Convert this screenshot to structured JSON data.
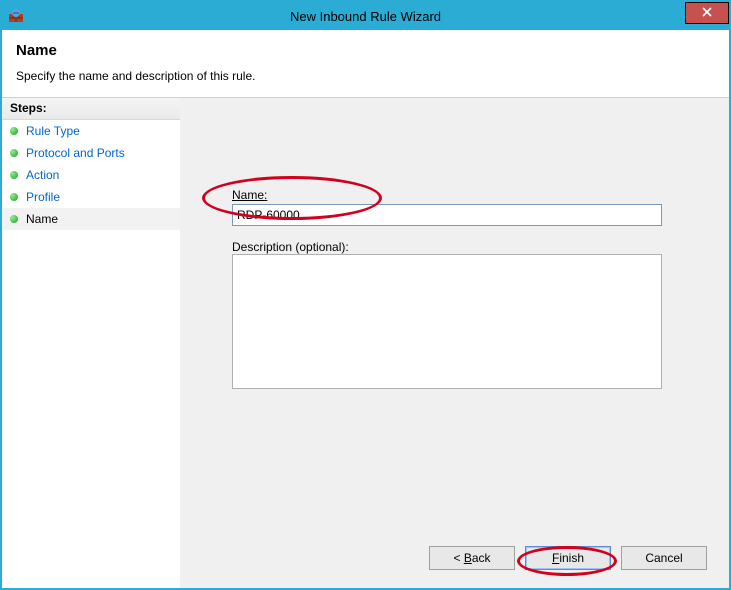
{
  "window": {
    "title": "New Inbound Rule Wizard"
  },
  "header": {
    "title": "Name",
    "subtitle": "Specify the name and description of this rule."
  },
  "sidebar": {
    "steps_label": "Steps:",
    "items": [
      {
        "label": "Rule Type"
      },
      {
        "label": "Protocol and Ports"
      },
      {
        "label": "Action"
      },
      {
        "label": "Profile"
      },
      {
        "label": "Name"
      }
    ]
  },
  "form": {
    "name_label": "Name:",
    "name_value": "RDP-60000",
    "description_label": "Description (optional):",
    "description_value": ""
  },
  "buttons": {
    "back": "< Back",
    "finish": "Finish",
    "cancel": "Cancel"
  }
}
